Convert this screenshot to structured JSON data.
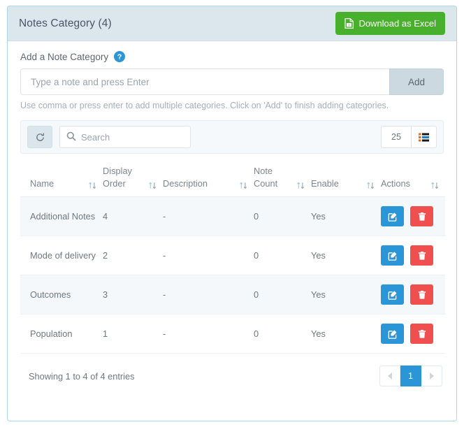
{
  "panel": {
    "title": "Notes Category (4)",
    "download_button": {
      "label": "Download as Excel",
      "icon": "excel-file-icon",
      "color": "#48b02c"
    }
  },
  "add_section": {
    "label": "Add a Note Category",
    "help_icon": "help-circle-icon",
    "input_placeholder": "Type a note and press Enter",
    "input_value": "",
    "add_button": "Add",
    "hint": "Use comma or press enter to add multiple categories. Click on 'Add' to finish adding categories."
  },
  "toolbar": {
    "refresh_icon": "refresh-icon",
    "search_icon": "search-icon",
    "search_placeholder": "Search",
    "search_value": "",
    "page_length": "25",
    "columns_icon": "columns-icon"
  },
  "table": {
    "columns": [
      {
        "label": "Name",
        "sortable": true
      },
      {
        "label": "Display Order",
        "sortable": true
      },
      {
        "label": "Description",
        "sortable": true
      },
      {
        "label": "Note Count",
        "sortable": true
      },
      {
        "label": "Enable",
        "sortable": true
      },
      {
        "label": "Actions",
        "sortable": true
      }
    ],
    "rows": [
      {
        "name": "Additional Notes",
        "display_order": "4",
        "description": "-",
        "note_count": "0",
        "enable": "Yes"
      },
      {
        "name": "Mode of delivery",
        "display_order": "2",
        "description": "-",
        "note_count": "0",
        "enable": "Yes"
      },
      {
        "name": "Outcomes",
        "display_order": "3",
        "description": "-",
        "note_count": "0",
        "enable": "Yes"
      },
      {
        "name": "Population",
        "display_order": "1",
        "description": "-",
        "note_count": "0",
        "enable": "Yes"
      }
    ],
    "row_actions": {
      "edit_icon": "edit-pencil-icon",
      "delete_icon": "trash-icon"
    }
  },
  "footer": {
    "info": "Showing 1 to 4 of 4 entries",
    "pagination": {
      "prev": "previous-page-arrow",
      "pages": [
        "1"
      ],
      "active_page": "1",
      "next": "next-page-arrow"
    }
  },
  "colors": {
    "accent_blue": "#2a96d8",
    "excel_green": "#48b02c",
    "danger_red": "#ef4f4f",
    "panel_header_bg": "#dce6ed",
    "panel_border": "#a8d8e8"
  }
}
